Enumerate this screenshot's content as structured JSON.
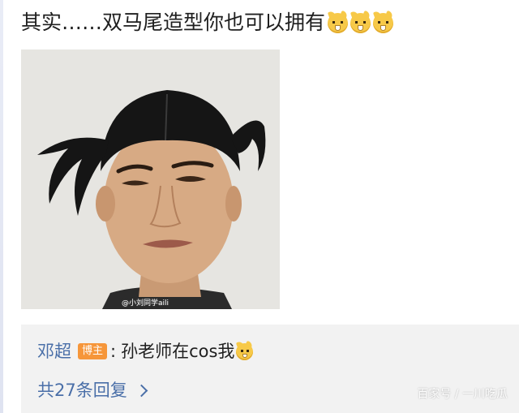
{
  "post": {
    "text": "其实……双马尾造型你也可以拥有",
    "emojis": [
      "doge-emoji",
      "doge-emoji",
      "doge-emoji"
    ]
  },
  "photo": {
    "watermark": "@小刘同学aili"
  },
  "comment": {
    "author": "邓超",
    "badge": "博主",
    "separator": ":",
    "text": "孙老师在cos我",
    "emoji": "doge-emoji"
  },
  "replies": {
    "label": "共27条回复"
  },
  "site_watermark": "百家号 / 一川吃瓜",
  "colors": {
    "link": "#4a6fa8",
    "badge": "#f6963a",
    "comment_bg": "#f2f2f2"
  }
}
